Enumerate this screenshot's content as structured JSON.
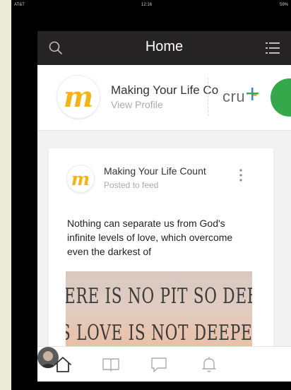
{
  "status_bar": {
    "carrier": "AT&T",
    "time": "12:16",
    "right": "59%"
  },
  "nav": {
    "title": "Home"
  },
  "profile": {
    "name": "Making Your Life Co",
    "link": "View Profile",
    "logo_letter": "m",
    "partner_logo": "cru"
  },
  "post": {
    "author": "Making Your Life Count",
    "meta": "Posted to feed",
    "body": "Nothing can separate us from God's infinite levels of love, which overcome even the darkest of",
    "image_text": [
      "ERE IS NO PIT SO DEEP, THA",
      "S LOVE IS NOT DEEPER STIL"
    ]
  },
  "tabs": [
    {
      "name": "home",
      "icon": "home-icon",
      "active": true
    },
    {
      "name": "book",
      "icon": "book-icon"
    },
    {
      "name": "chat",
      "icon": "chat-icon"
    },
    {
      "name": "notifications",
      "icon": "bell-icon"
    },
    {
      "name": "profile",
      "icon": "avatar"
    }
  ],
  "colors": {
    "nav_bg": "#262325",
    "logo_yellow": "#f3b41b",
    "cru_green": "#35a84b",
    "cru_blue": "#3a88c8",
    "cru_yellow": "#f2b518"
  }
}
